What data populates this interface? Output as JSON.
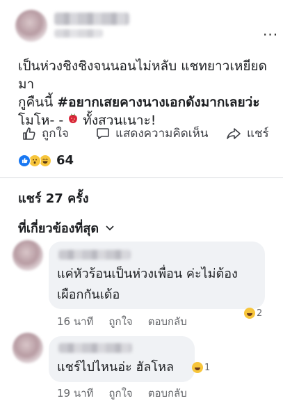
{
  "post": {
    "menu_label": "...",
    "text_line1": "เป็นห่วงชิงชิงจนนอนไม่หลับ แชทยาวเหยียดมา",
    "text_line2_prefix": "กูคืนนี้ ",
    "hashtag": "#อยากเสยคางนางเอกดังมากเลยว่ะ",
    "text_line3_prefix": "โมโห- - ",
    "text_line3_suffix": " ทั้งสวนเนาะ!"
  },
  "actions": {
    "like_label": "ถูกใจ",
    "comment_label": "แสดงความคิดเห็น",
    "share_label": "แชร์"
  },
  "reactions": {
    "count": "64"
  },
  "shares_text": "แชร์ 27 ครั้ง",
  "sort_label": "ที่เกี่ยวข้องที่สุด",
  "comments": [
    {
      "line1": "แค่หัวร้อนเป็นห่วงเพื่อน ค่ะไม่ต้อง",
      "line2": "เผือกกันเด้อ",
      "time": "16 นาที",
      "like": "ถูกใจ",
      "reply": "ตอบกลับ",
      "reaction_count": "2"
    },
    {
      "line1": "แชร์ไปไหนอ่ะ ฮัลโหล",
      "time": "19 นาที",
      "like": "ถูกใจ",
      "reply": "ตอบกลับ",
      "reaction_count": "1"
    }
  ],
  "colors": {
    "text": "#1c1e21",
    "muted": "#65676b",
    "bubble": "#f0f2f5",
    "like_blue": "#1877f2",
    "love_red": "#f33e58",
    "haha_yellow": "#f7c53b"
  },
  "icons": [
    "more-icon",
    "thumbs-up-icon",
    "comment-icon",
    "share-icon",
    "like-reaction-icon",
    "wow-reaction-icon",
    "haha-reaction-icon",
    "strawberry-icon",
    "chevron-down-icon"
  ]
}
